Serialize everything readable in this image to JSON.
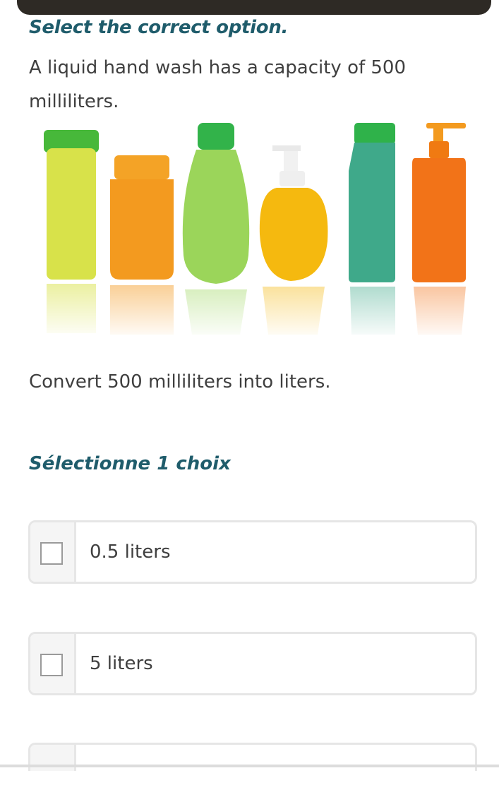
{
  "header": {
    "instruction": "Select the correct option."
  },
  "question": {
    "text": "A liquid hand wash has a capacity of 500 milliliters.",
    "prompt": "Convert 500 milliliters into liters."
  },
  "choices": {
    "label": "Sélectionne 1 choix",
    "options": [
      {
        "label": "0.5 liters"
      },
      {
        "label": "5 liters"
      },
      {
        "label": ""
      }
    ]
  },
  "colors": {
    "heading": "#1f5c6b",
    "text": "#3f3f3f",
    "border": "#e6e6e6"
  }
}
